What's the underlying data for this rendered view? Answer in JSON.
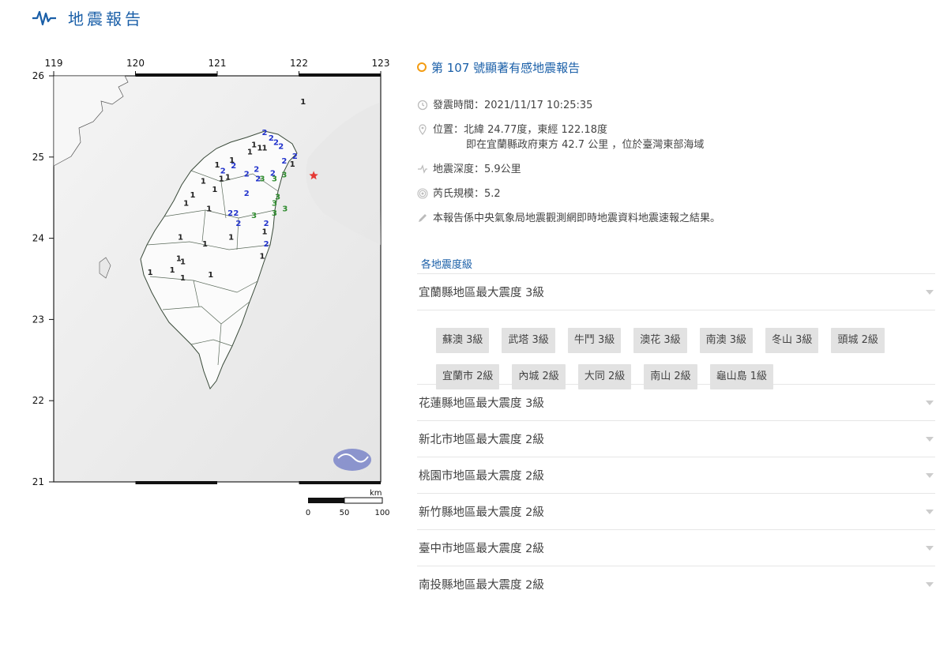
{
  "header": {
    "title": "地震報告",
    "icon": "seismic-wave-icon",
    "accent": "#1a5fa8"
  },
  "map": {
    "lon_ticks": [
      "119",
      "120",
      "121",
      "122",
      "123"
    ],
    "lat_ticks": [
      "26",
      "25",
      "24",
      "23",
      "22",
      "21"
    ],
    "scale": {
      "unit": "km",
      "labels": [
        "0",
        "50",
        "100"
      ]
    },
    "epicenter": {
      "lat": 24.77,
      "lon": 122.18,
      "symbol": "star",
      "color": "#e53935"
    },
    "intensity_marks": [
      {
        "v": "1",
        "lon": 122.05,
        "lat": 25.65,
        "c": "#222"
      },
      {
        "v": "2",
        "lon": 121.58,
        "lat": 25.27,
        "c": "#2233cc"
      },
      {
        "v": "2",
        "lon": 121.66,
        "lat": 25.2,
        "c": "#2233cc"
      },
      {
        "v": "2",
        "lon": 121.72,
        "lat": 25.15,
        "c": "#2233cc"
      },
      {
        "v": "2",
        "lon": 121.95,
        "lat": 24.98,
        "c": "#2233cc"
      },
      {
        "v": "1",
        "lon": 121.45,
        "lat": 25.12,
        "c": "#222"
      },
      {
        "v": "1",
        "lon": 121.52,
        "lat": 25.08,
        "c": "#222"
      },
      {
        "v": "1",
        "lon": 121.58,
        "lat": 25.08,
        "c": "#222"
      },
      {
        "v": "1",
        "lon": 121.4,
        "lat": 25.03,
        "c": "#222"
      },
      {
        "v": "2",
        "lon": 121.78,
        "lat": 25.1,
        "c": "#2233cc"
      },
      {
        "v": "2",
        "lon": 121.82,
        "lat": 24.92,
        "c": "#2233cc"
      },
      {
        "v": "1",
        "lon": 121.92,
        "lat": 24.88,
        "c": "#222"
      },
      {
        "v": "1",
        "lon": 121.0,
        "lat": 24.87,
        "c": "#222"
      },
      {
        "v": "1",
        "lon": 121.18,
        "lat": 24.93,
        "c": "#222"
      },
      {
        "v": "2",
        "lon": 121.2,
        "lat": 24.86,
        "c": "#2233cc"
      },
      {
        "v": "2",
        "lon": 121.07,
        "lat": 24.8,
        "c": "#2233cc"
      },
      {
        "v": "1",
        "lon": 121.13,
        "lat": 24.72,
        "c": "#222"
      },
      {
        "v": "1",
        "lon": 121.05,
        "lat": 24.7,
        "c": "#222"
      },
      {
        "v": "2",
        "lon": 121.48,
        "lat": 24.82,
        "c": "#2233cc"
      },
      {
        "v": "2",
        "lon": 121.36,
        "lat": 24.76,
        "c": "#2233cc"
      },
      {
        "v": "2",
        "lon": 121.5,
        "lat": 24.7,
        "c": "#2233cc"
      },
      {
        "v": "3",
        "lon": 121.55,
        "lat": 24.7,
        "c": "#2e8b2e"
      },
      {
        "v": "2",
        "lon": 121.68,
        "lat": 24.77,
        "c": "#2233cc"
      },
      {
        "v": "3",
        "lon": 121.7,
        "lat": 24.7,
        "c": "#2e8b2e"
      },
      {
        "v": "3",
        "lon": 121.82,
        "lat": 24.75,
        "c": "#2e8b2e"
      },
      {
        "v": "1",
        "lon": 120.83,
        "lat": 24.67,
        "c": "#222"
      },
      {
        "v": "1",
        "lon": 120.97,
        "lat": 24.57,
        "c": "#222"
      },
      {
        "v": "1",
        "lon": 120.7,
        "lat": 24.5,
        "c": "#222"
      },
      {
        "v": "2",
        "lon": 121.36,
        "lat": 24.52,
        "c": "#2233cc"
      },
      {
        "v": "3",
        "lon": 121.74,
        "lat": 24.48,
        "c": "#2e8b2e"
      },
      {
        "v": "3",
        "lon": 121.7,
        "lat": 24.4,
        "c": "#2e8b2e"
      },
      {
        "v": "3",
        "lon": 121.83,
        "lat": 24.33,
        "c": "#2e8b2e"
      },
      {
        "v": "1",
        "lon": 120.62,
        "lat": 24.4,
        "c": "#222"
      },
      {
        "v": "1",
        "lon": 120.9,
        "lat": 24.33,
        "c": "#222"
      },
      {
        "v": "2",
        "lon": 121.16,
        "lat": 24.28,
        "c": "#2233cc"
      },
      {
        "v": "2",
        "lon": 121.23,
        "lat": 24.28,
        "c": "#2233cc"
      },
      {
        "v": "2",
        "lon": 121.26,
        "lat": 24.15,
        "c": "#2233cc"
      },
      {
        "v": "3",
        "lon": 121.45,
        "lat": 24.25,
        "c": "#2e8b2e"
      },
      {
        "v": "3",
        "lon": 121.7,
        "lat": 24.28,
        "c": "#2e8b2e"
      },
      {
        "v": "2",
        "lon": 121.6,
        "lat": 24.15,
        "c": "#2233cc"
      },
      {
        "v": "1",
        "lon": 121.58,
        "lat": 24.05,
        "c": "#222"
      },
      {
        "v": "1",
        "lon": 120.55,
        "lat": 23.98,
        "c": "#222"
      },
      {
        "v": "1",
        "lon": 120.85,
        "lat": 23.9,
        "c": "#222"
      },
      {
        "v": "1",
        "lon": 121.17,
        "lat": 23.98,
        "c": "#222"
      },
      {
        "v": "2",
        "lon": 121.6,
        "lat": 23.9,
        "c": "#2233cc"
      },
      {
        "v": "1",
        "lon": 121.55,
        "lat": 23.75,
        "c": "#222"
      },
      {
        "v": "1",
        "lon": 120.53,
        "lat": 23.72,
        "c": "#222"
      },
      {
        "v": "1",
        "lon": 120.58,
        "lat": 23.68,
        "c": "#222"
      },
      {
        "v": "1",
        "lon": 120.18,
        "lat": 23.55,
        "c": "#222"
      },
      {
        "v": "1",
        "lon": 120.45,
        "lat": 23.58,
        "c": "#222"
      },
      {
        "v": "1",
        "lon": 120.58,
        "lat": 23.48,
        "c": "#222"
      },
      {
        "v": "1",
        "lon": 120.92,
        "lat": 23.52,
        "c": "#222"
      }
    ]
  },
  "report": {
    "title": "第 107 號顯著有感地震報告",
    "time": "發震時間：2021/11/17 10:25:35",
    "location_line1": "位置：北緯 24.77度，東經 122.18度",
    "location_line2": "即在宜蘭縣政府東方 42.7 公里 ，位於臺灣東部海域",
    "depth": "地震深度：5.9公里",
    "magnitude": "芮氏規模：5.2",
    "note": "本報告係中央氣象局地震觀測網即時地震資料地震速報之結果。"
  },
  "section_title": "各地震度級",
  "regions": [
    {
      "label": "宜蘭縣地區最大震度 3級",
      "expanded": true,
      "stations": [
        "蘇澳 3級",
        "武塔 3級",
        "牛鬥 3級",
        "澳花 3級",
        "南澳 3級",
        "冬山 3級",
        "頭城 2級",
        "宜蘭市 2級",
        "內城 2級",
        "大同 2級",
        "南山 2級",
        "龜山島 1級"
      ]
    },
    {
      "label": "花蓮縣地區最大震度 3級",
      "expanded": false
    },
    {
      "label": "新北市地區最大震度 2級",
      "expanded": false
    },
    {
      "label": "桃園市地區最大震度 2級",
      "expanded": false
    },
    {
      "label": "新竹縣地區最大震度 2級",
      "expanded": false
    },
    {
      "label": "臺中市地區最大震度 2級",
      "expanded": false
    },
    {
      "label": "南投縣地區最大震度 2級",
      "expanded": false
    }
  ]
}
